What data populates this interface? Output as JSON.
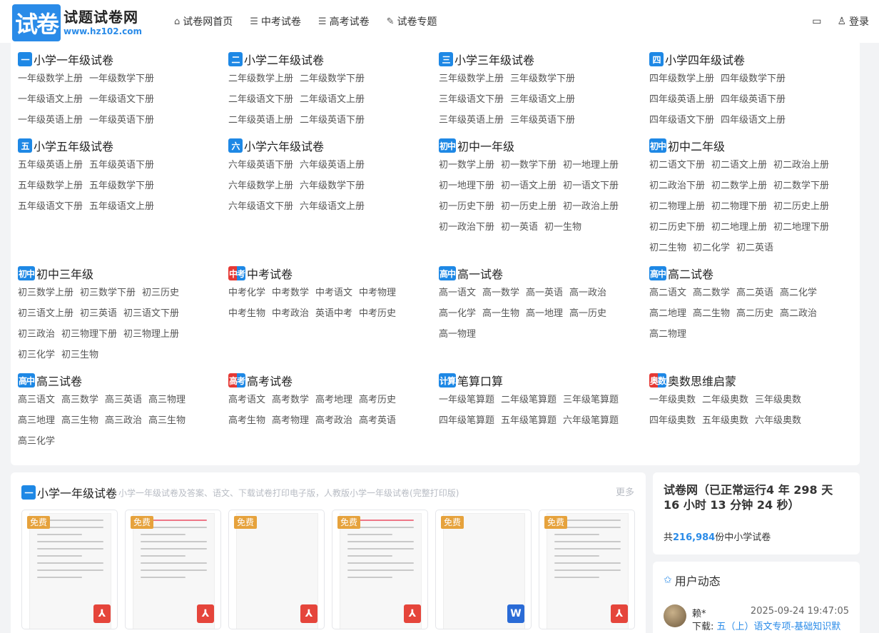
{
  "header": {
    "logo_mark": "试卷",
    "logo_name": "试题试卷网",
    "logo_url": "www.hz102.com",
    "nav": [
      {
        "icon": "⌂",
        "icon_name": "home-icon",
        "label": "试卷网首页"
      },
      {
        "icon": "☰",
        "icon_name": "menu-icon",
        "label": "中考试卷"
      },
      {
        "icon": "☰",
        "icon_name": "menu-icon",
        "label": "高考试卷"
      },
      {
        "icon": "✎",
        "icon_name": "pen-icon",
        "label": "试卷专题"
      }
    ],
    "monitor_icon": "▭",
    "user_icon": "♙",
    "login_label": "登录"
  },
  "categories": [
    {
      "badge": "一",
      "color": "blue",
      "title": "小学一年级试卷",
      "links": [
        "一年级数学上册",
        "一年级数学下册",
        "一年级语文上册",
        "一年级语文下册",
        "一年级英语上册",
        "一年级英语下册"
      ]
    },
    {
      "badge": "二",
      "color": "blue",
      "title": "小学二年级试卷",
      "links": [
        "二年级数学上册",
        "二年级数学下册",
        "二年级语文下册",
        "二年级语文上册",
        "二年级英语上册",
        "二年级英语下册"
      ]
    },
    {
      "badge": "三",
      "color": "blue",
      "title": "小学三年级试卷",
      "links": [
        "三年级数学上册",
        "三年级数学下册",
        "三年级语文下册",
        "三年级语文上册",
        "三年级英语上册",
        "三年级英语下册"
      ]
    },
    {
      "badge": "四",
      "color": "blue",
      "title": "小学四年级试卷",
      "links": [
        "四年级数学上册",
        "四年级数学下册",
        "四年级英语上册",
        "四年级英语下册",
        "四年级语文下册",
        "四年级语文上册"
      ]
    },
    {
      "badge": "五",
      "color": "blue",
      "title": "小学五年级试卷",
      "links": [
        "五年级英语上册",
        "五年级英语下册",
        "五年级数学上册",
        "五年级数学下册",
        "五年级语文下册",
        "五年级语文上册"
      ]
    },
    {
      "badge": "六",
      "color": "blue",
      "title": "小学六年级试卷",
      "links": [
        "六年级英语下册",
        "六年级英语上册",
        "六年级数学上册",
        "六年级数学下册",
        "六年级语文下册",
        "六年级语文上册"
      ]
    },
    {
      "badge": "初中",
      "color": "blue",
      "title": "初中一年级",
      "links": [
        "初一数学上册",
        "初一数学下册",
        "初一地理上册",
        "初一地理下册",
        "初一语文上册",
        "初一语文下册",
        "初一历史下册",
        "初一历史上册",
        "初一政治上册",
        "初一政治下册",
        "初一英语",
        "初一生物"
      ]
    },
    {
      "badge": "初中",
      "color": "blue",
      "title": "初中二年级",
      "links": [
        "初二语文下册",
        "初二语文上册",
        "初二政治上册",
        "初二政治下册",
        "初二数学上册",
        "初二数学下册",
        "初二物理上册",
        "初二物理下册",
        "初二历史上册",
        "初二历史下册",
        "初二地理上册",
        "初二地理下册",
        "初二生物",
        "初二化学",
        "初二英语"
      ]
    },
    {
      "badge": "初中",
      "color": "blue",
      "title": "初中三年级",
      "links": [
        "初三数学上册",
        "初三数学下册",
        "初三历史",
        "初三语文上册",
        "初三英语",
        "初三语文下册",
        "初三政治",
        "初三物理下册",
        "初三物理上册",
        "初三化学",
        "初三生物"
      ]
    },
    {
      "badge": "中考",
      "color": "mix",
      "title": "中考试卷",
      "links": [
        "中考化学",
        "中考数学",
        "中考语文",
        "中考物理",
        "中考生物",
        "中考政治",
        "英语中考",
        "中考历史"
      ]
    },
    {
      "badge": "高中",
      "color": "blue",
      "title": "高一试卷",
      "links": [
        "高一语文",
        "高一数学",
        "高一英语",
        "高一政治",
        "高一化学",
        "高一生物",
        "高一地理",
        "高一历史",
        "高一物理"
      ]
    },
    {
      "badge": "高中",
      "color": "blue",
      "title": "高二试卷",
      "links": [
        "高二语文",
        "高二数学",
        "高二英语",
        "高二化学",
        "高二地理",
        "高二生物",
        "高二历史",
        "高二政治",
        "高二物理"
      ]
    },
    {
      "badge": "高中",
      "color": "blue",
      "title": "高三试卷",
      "links": [
        "高三语文",
        "高三数学",
        "高三英语",
        "高三物理",
        "高三地理",
        "高三生物",
        "高三政治",
        "高三生物",
        "高三化学"
      ]
    },
    {
      "badge": "高考",
      "color": "mix",
      "title": "高考试卷",
      "links": [
        "高考语文",
        "高考数学",
        "高考地理",
        "高考历史",
        "高考生物",
        "高考物理",
        "高考政治",
        "高考英语"
      ]
    },
    {
      "badge": "计算",
      "color": "blue",
      "title": "笔算口算",
      "links": [
        "一年级笔算题",
        "二年级笔算题",
        "三年级笔算题",
        "四年级笔算题",
        "五年级笔算题",
        "六年级笔算题"
      ]
    },
    {
      "badge": "奥数",
      "color": "mix",
      "title": "奥数思维启蒙",
      "links": [
        "一年级奥数",
        "二年级奥数",
        "三年级奥数",
        "四年级奥数",
        "五年级奥数",
        "六年级奥数"
      ]
    }
  ],
  "list_panel": {
    "badge": "一",
    "title": "小学一年级试卷",
    "desc": "小学一年级试卷及答案、语文、下载试卷打印电子版，人教版小学一年级试卷(完整打印版)",
    "more": "更多",
    "free_label": "免费",
    "items": [
      {
        "file": "pdf",
        "icon_name": "pdf-icon"
      },
      {
        "file": "pdf",
        "icon_name": "pdf-icon"
      },
      {
        "file": "pdf",
        "icon_name": "pdf-icon"
      },
      {
        "file": "pdf",
        "icon_name": "pdf-icon"
      },
      {
        "file": "doc",
        "icon_name": "word-icon"
      },
      {
        "file": "pdf",
        "icon_name": "pdf-icon"
      }
    ]
  },
  "stats": {
    "title": "试卷网（已正常运行4 年 298 天 16 小时 13 分钟 24 秒）",
    "count_prefix": "共",
    "count": "216,984",
    "count_suffix": "份中小学试卷"
  },
  "dynamics": {
    "icon": "✩",
    "title": "用户动态",
    "user": "赖*",
    "time": "2025-09-24 19:47:05",
    "action": "下载:",
    "link": "五（上）语文专项-基础知识默"
  }
}
